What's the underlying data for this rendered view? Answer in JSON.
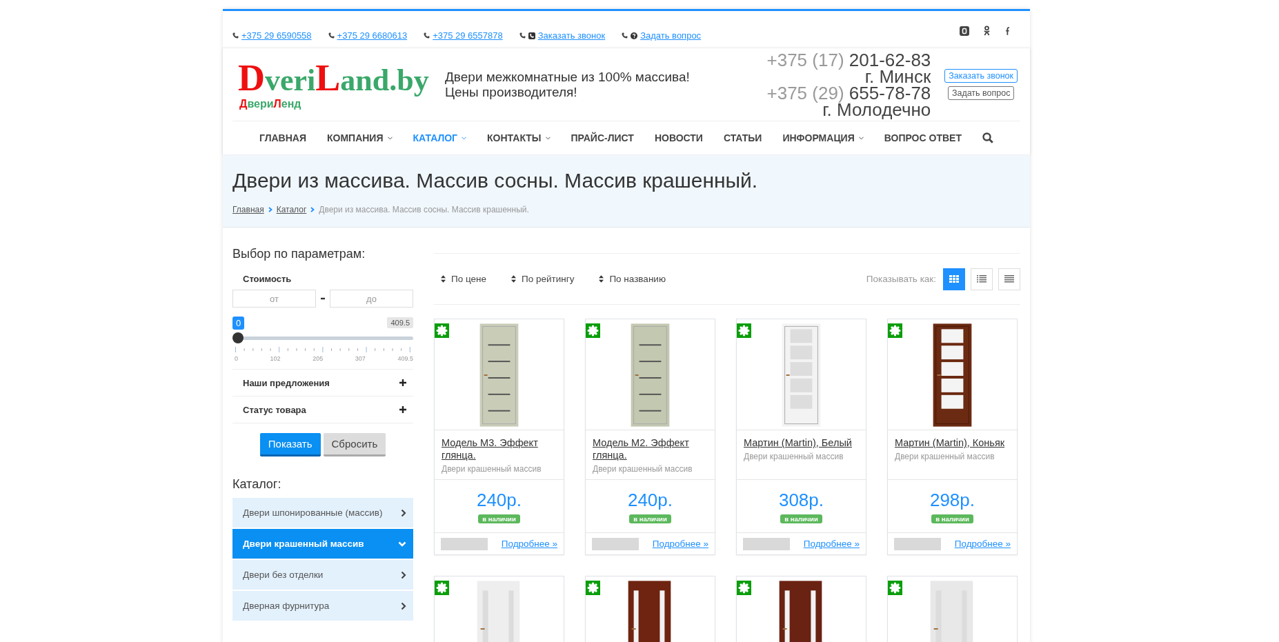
{
  "top_links": [
    {
      "text": "+375 29 6590558",
      "kind": "phone"
    },
    {
      "text": "+375 29 6680613",
      "kind": "phone"
    },
    {
      "text": "+375 29 6557878",
      "kind": "phone"
    },
    {
      "text": "Заказать звонок",
      "kind": "callback"
    },
    {
      "text": "Задать вопрос",
      "kind": "question"
    }
  ],
  "social": [
    {
      "kind": "vk"
    },
    {
      "kind": "ok"
    },
    {
      "kind": "facebook"
    }
  ],
  "logo": {
    "parts": [
      {
        "text": "D",
        "kind": "accent"
      },
      {
        "text": "veri",
        "kind": "plain"
      },
      {
        "text": "L",
        "kind": "accent"
      },
      {
        "text": "and.by",
        "kind": "plain"
      }
    ],
    "sub_parts": [
      {
        "text": "Д",
        "kind": "accent"
      },
      {
        "text": "вери",
        "kind": "plain"
      },
      {
        "text": "Л",
        "kind": "accent"
      },
      {
        "text": "енд",
        "kind": "plain"
      }
    ]
  },
  "tagline": [
    "Двери межкомнатные из 100% массива!",
    "Цены производителя!"
  ],
  "phones": [
    {
      "prefix": "+375 (17)",
      "number": "201-62-83",
      "city": "г. Минск"
    },
    {
      "prefix": "+375 (29)",
      "number": "655-78-78",
      "city": "г. Молодечно"
    }
  ],
  "header_buttons": [
    {
      "label": "Заказать звонок",
      "kind": "primary"
    },
    {
      "label": "Задать вопрос",
      "kind": "secondary"
    }
  ],
  "nav": [
    {
      "label": "ГЛАВНАЯ",
      "selected": false,
      "dropdown": false
    },
    {
      "label": "КОМПАНИЯ",
      "selected": false,
      "dropdown": true
    },
    {
      "label": "КАТАЛОГ",
      "selected": true,
      "dropdown": true
    },
    {
      "label": "КОНТАКТЫ",
      "selected": false,
      "dropdown": true
    },
    {
      "label": "ПРАЙС-ЛИСТ",
      "selected": false,
      "dropdown": false
    },
    {
      "label": "НОВОСТИ",
      "selected": false,
      "dropdown": false
    },
    {
      "label": "СТАТЬИ",
      "selected": false,
      "dropdown": false
    },
    {
      "label": "ИНФОРМАЦИЯ",
      "selected": false,
      "dropdown": true
    },
    {
      "label": "ВОПРОС ОТВЕТ",
      "selected": false,
      "dropdown": false
    }
  ],
  "title": "Двери из массива. Массив сосны. Массив крашенный.",
  "breadcrumbs": [
    {
      "text": "Главная",
      "kind": "link"
    },
    {
      "text": "Каталог",
      "kind": "link"
    },
    {
      "text": "Двери из массива. Массив сосны. Массив крашенный.",
      "kind": "current"
    }
  ],
  "filter": {
    "heading": "Выбор по параметрам:",
    "price_label": "Стоимость",
    "from": {
      "placeholder": "от"
    },
    "to": {
      "placeholder": "до"
    },
    "slider": {
      "level": 0,
      "min_label": "0",
      "max_label": "409.5",
      "ticks": [
        "0",
        "102",
        "205",
        "307",
        "409.5"
      ]
    },
    "sections": [
      {
        "label": "Наши предложения",
        "expanded": false
      },
      {
        "label": "Статус товара",
        "expanded": false
      }
    ],
    "buttons": [
      {
        "label": "Показать",
        "kind": "primary"
      },
      {
        "label": "Сбросить",
        "kind": "secondary"
      }
    ]
  },
  "catalog": {
    "heading": "Каталог:",
    "items": [
      {
        "label": "Двери шпонированные (массив)",
        "selected": false
      },
      {
        "label": "Двери крашенный массив",
        "selected": true
      },
      {
        "label": "Двери без отделки",
        "selected": false
      },
      {
        "label": "Дверная фурнитура",
        "selected": false
      }
    ]
  },
  "sort": [
    {
      "label": "По цене"
    },
    {
      "label": "По рейтингу"
    },
    {
      "label": "По названию"
    }
  ],
  "view": {
    "label": "Показывать как:",
    "modes": [
      {
        "kind": "grid",
        "selected": true
      },
      {
        "kind": "list",
        "selected": false
      },
      {
        "kind": "table",
        "selected": false
      }
    ]
  },
  "products": [
    {
      "kind": "picture",
      "name": "Модель М3. Эффект глянца.",
      "category": "Двери крашенный массив",
      "price": "240р.",
      "status": "в наличии",
      "more": "Подробнее »"
    },
    {
      "kind": "picture",
      "name": "Модель М2. Эффект глянца.",
      "category": "Двери крашенный массив",
      "price": "240р.",
      "status": "в наличии",
      "more": "Подробнее »"
    },
    {
      "kind": "picture",
      "name": "Мартин (Martin), Белый",
      "category": "Двери крашенный массив",
      "price": "308р.",
      "status": "в наличии",
      "more": "Подробнее »"
    },
    {
      "kind": "picture",
      "name": "Мартин (Martin), Коньяк",
      "category": "Двери крашенный массив",
      "price": "298р.",
      "status": "в наличии",
      "more": "Подробнее »"
    }
  ],
  "more_products": [
    {
      "kind": "picture"
    },
    {
      "kind": "picture"
    },
    {
      "kind": "picture"
    },
    {
      "kind": "picture"
    }
  ]
}
